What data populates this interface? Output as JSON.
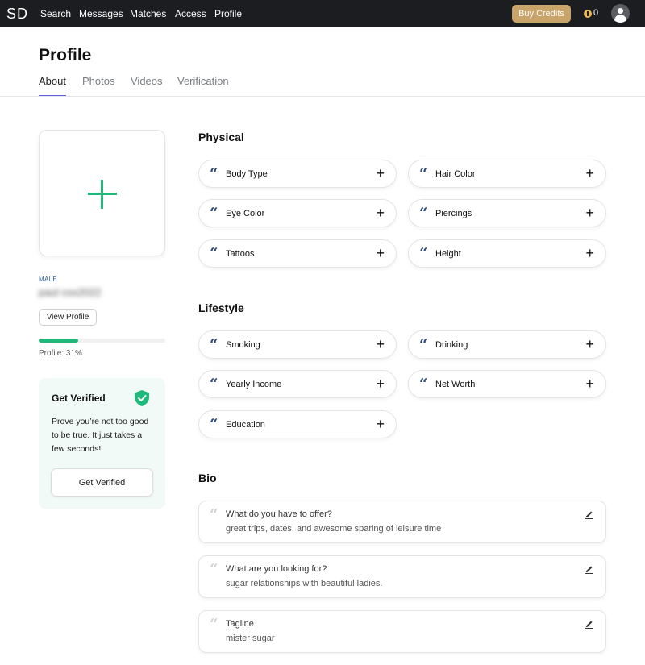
{
  "nav": {
    "logo": "SD",
    "links": [
      "Search",
      "Messages",
      "Matches",
      "Access",
      "Profile"
    ],
    "buy_credits": "Buy Credits",
    "credits": "0"
  },
  "header": {
    "title": "Profile",
    "tabs": [
      "About",
      "Photos",
      "Videos",
      "Verification"
    ]
  },
  "sidebar": {
    "gender": "MALE",
    "username": "paul cox2022",
    "view_profile": "View Profile",
    "profile_progress_percent": 31,
    "progress_label": "Profile: 31%",
    "verify": {
      "title": "Get Verified",
      "text": "Prove you’re not too good to be true. It just takes a few seconds!",
      "button": "Get Verified"
    }
  },
  "sections": {
    "physical": {
      "title": "Physical",
      "items": [
        "Body Type",
        "Hair Color",
        "Eye Color",
        "Piercings",
        "Tattoos",
        "Height"
      ]
    },
    "lifestyle": {
      "title": "Lifestyle",
      "items": [
        "Smoking",
        "Drinking",
        "Yearly Income",
        "Net Worth",
        "Education"
      ]
    },
    "bio": {
      "title": "Bio",
      "items": [
        {
          "question": "What do you have to offer?",
          "answer": "great trips, dates, and awesome sparing of leisure time"
        },
        {
          "question": "What are you looking for?",
          "answer": "sugar relationships with beautiful ladies."
        },
        {
          "question": "Tagline",
          "answer": "mister sugar"
        }
      ]
    }
  },
  "colors": {
    "accent_green": "#1fb87a",
    "tab_underline": "#5b63e8",
    "buy_credits": "#c8a46b",
    "quote_blue": "#2b4a7a",
    "verify_bg": "#f1faf6"
  },
  "icons": {
    "add": "+",
    "quote": "“"
  }
}
